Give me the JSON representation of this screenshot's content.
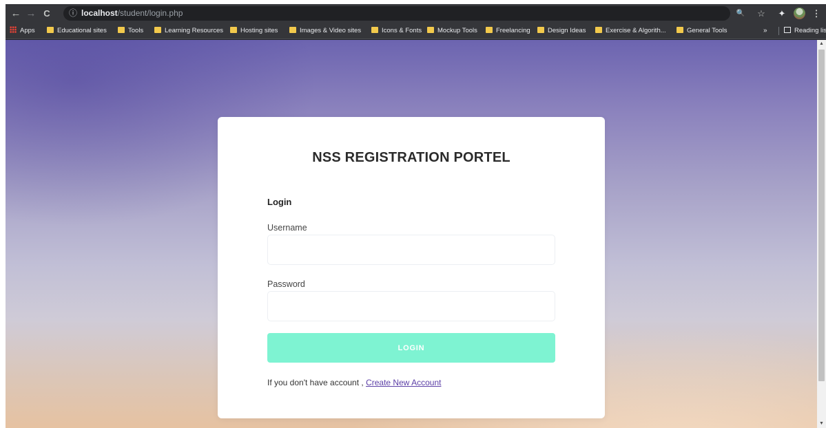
{
  "browser": {
    "url_host": "localhost",
    "url_path": "/student/login.php",
    "icons": {
      "back": "←",
      "forward": "→",
      "reload": "C",
      "info": "ⓘ",
      "zoom": "🔍",
      "star": "☆",
      "extensions": "✦",
      "menu": "⋮"
    }
  },
  "bookmarks": {
    "items": [
      {
        "label": "Apps"
      },
      {
        "label": "Educational sites"
      },
      {
        "label": "Tools"
      },
      {
        "label": "Learning Resources"
      },
      {
        "label": "Hosting sites"
      },
      {
        "label": "Images & Video sites"
      },
      {
        "label": "Icons & Fonts"
      },
      {
        "label": "Mockup Tools"
      },
      {
        "label": "Freelancing"
      },
      {
        "label": "Design Ideas"
      },
      {
        "label": "Exercise & Algorith..."
      },
      {
        "label": "General Tools"
      }
    ],
    "overflow": "»",
    "reading_list": "Reading list"
  },
  "form": {
    "title": "NSS REGISTRATION PORTEL",
    "section_title": "Login",
    "username_label": "Username",
    "username_value": "",
    "password_label": "Password",
    "password_value": "",
    "login_button": "LOGIN",
    "signup_prompt": "If you don't have account ,",
    "signup_link": "Create New Account"
  },
  "colors": {
    "login_button": "#7ef3d2",
    "link": "#5b3ea6",
    "folder": "#f2c94c"
  }
}
